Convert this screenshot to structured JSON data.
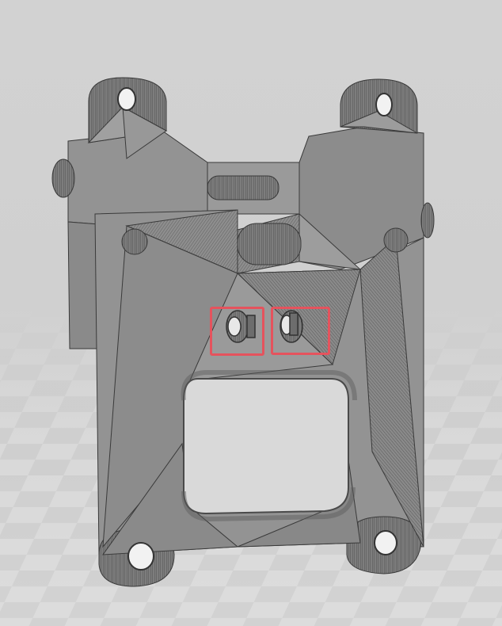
{
  "scene": {
    "subject": "3d-printed-bracket-mesh",
    "colors": {
      "background": "#d0d0d0",
      "floor_tile_light": "#dedede",
      "floor_tile_dark": "#cbcbcb",
      "mesh_face": "#8f8f8f",
      "mesh_face_dark": "#6f6f6f",
      "mesh_face_light": "#a3a3a3",
      "mesh_edge": "#3a3a3a",
      "highlight": "#e5535d"
    },
    "highlights": [
      {
        "name": "left-screw-hole-highlight"
      },
      {
        "name": "right-screw-hole-highlight"
      }
    ]
  }
}
